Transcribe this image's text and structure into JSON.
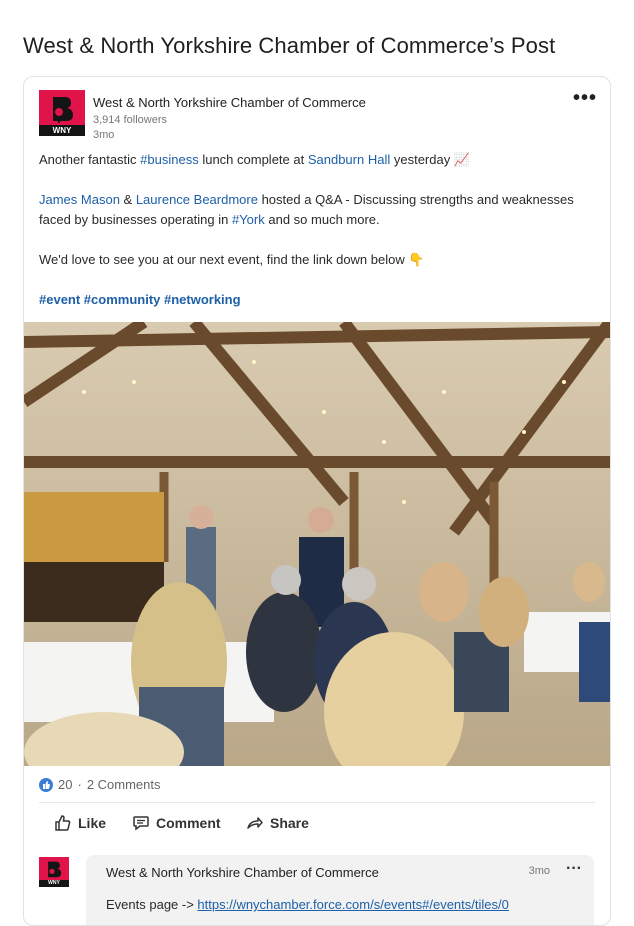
{
  "page": {
    "title": "West & North Yorkshire Chamber of Commerce’s Post"
  },
  "post": {
    "author": "West & North Yorkshire Chamber of Commerce",
    "followers": "3,914 followers",
    "age": "3mo",
    "logo_text": "WNY",
    "more": "•••",
    "line1": {
      "t1": "Another fantastic ",
      "tag_business": "#business",
      "t2": " lunch complete at ",
      "place": "Sandburn Hall",
      "t3": " yesterday ",
      "emoji": "📈"
    },
    "line2": {
      "person1": "James Mason",
      "amp": " & ",
      "person2": "Laurence Beardmore",
      "t1": " hosted a Q&A - Discussing strengths and weaknesses",
      "t2": "faced by businesses operating in ",
      "tag_york": "#York",
      "t3": " and so much more."
    },
    "line3": {
      "text": "We'd love to see you at our next event, find the link down below ",
      "emoji": "👇"
    },
    "hashtags": "#event #community #networking"
  },
  "social": {
    "reaction_count": "20",
    "separator": " · ",
    "comments": "2 Comments",
    "actions": {
      "like": "Like",
      "comment": "Comment",
      "share": "Share"
    }
  },
  "comment": {
    "author": "West & North Yorkshire Chamber of Commerce",
    "age": "3mo",
    "more": "···",
    "logo_text": "WNY",
    "prefix": "Events page -> ",
    "link": "https://wnychamber.force.com/s/events#/events/tiles/0"
  },
  "colors": {
    "brand": "#e0134a",
    "link": "#1d5fa8",
    "like": "#3a7fd5"
  }
}
